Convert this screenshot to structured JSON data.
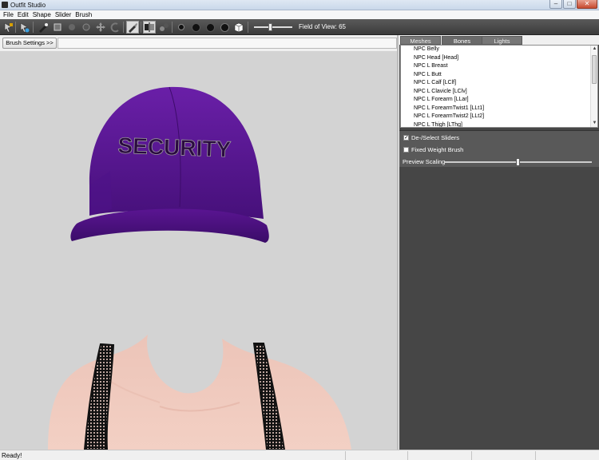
{
  "window": {
    "title": "Outfit Studio",
    "minimize": "–",
    "maximize": "□",
    "close": "✕"
  },
  "menu": [
    "File",
    "Edit",
    "Shape",
    "Slider",
    "Brush"
  ],
  "toolbar": {
    "fov_label": "Field of View: 65",
    "fov_value": 65
  },
  "viewport": {
    "brush_settings_label": "Brush Settings >>",
    "hat_text": "SECURITY",
    "hat_color": "#5a1592",
    "skin_color": "#f1c9bd",
    "background_color": "#d3d3d3"
  },
  "panel": {
    "tabs": [
      {
        "label": "Meshes",
        "active": false
      },
      {
        "label": "Bones",
        "active": true
      },
      {
        "label": "Lights",
        "active": false
      }
    ],
    "bones": [
      "NPC Belly",
      "NPC Head [Head]",
      "NPC L Breast",
      "NPC L Butt",
      "NPC L Calf [LClf]",
      "NPC L Clavicle [LClv]",
      "NPC L Forearm [LLar]",
      "NPC L ForearmTwist1 [LLt1]",
      "NPC L ForearmTwist2 [LLt2]",
      "NPC L Thigh [LThg]"
    ],
    "options": {
      "deselect_sliders": {
        "label": "De-/Select Sliders",
        "checked": true
      },
      "fixed_weight_brush": {
        "label": "Fixed Weight Brush",
        "checked": false
      },
      "preview_scaling": {
        "label": "Preview Scaling",
        "value": 0.5
      }
    },
    "panel_color": "#464646"
  },
  "status": {
    "text": "Ready!"
  }
}
